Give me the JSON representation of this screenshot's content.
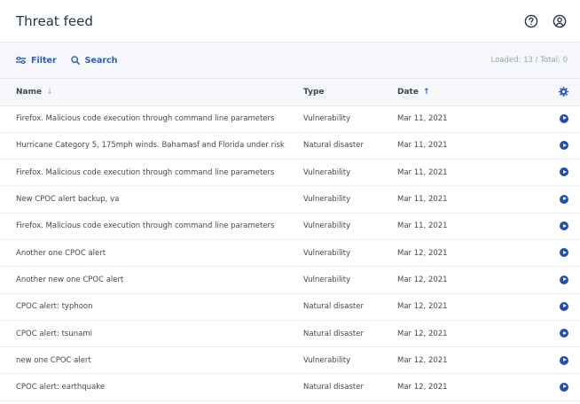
{
  "header": {
    "title": "Threat feed",
    "help_icon": "help-circle-icon",
    "account_icon": "user-circle-icon"
  },
  "toolbar": {
    "filter_label": "Filter",
    "search_label": "Search",
    "loaded_text": "Loaded: 13 / Total: 0"
  },
  "table": {
    "columns": {
      "name": "Name",
      "type": "Type",
      "date": "Date"
    },
    "sort": {
      "column": "Date",
      "direction": "ascending"
    },
    "rows": [
      {
        "name": "Firefox. Malicious code execution through command line parameters",
        "type": "Vulnerability",
        "date": "Mar 11, 2021"
      },
      {
        "name": "Hurricane Category 5, 175mph winds. Bahamasf and Florida under risk",
        "type": "Natural disaster",
        "date": "Mar 11, 2021"
      },
      {
        "name": "Firefox. Malicious code execution through command line parameters",
        "type": "Vulnerability",
        "date": "Mar 11, 2021"
      },
      {
        "name": "New CPOC alert backup, va",
        "type": "Vulnerability",
        "date": "Mar 11, 2021"
      },
      {
        "name": "Firefox. Malicious code execution through command line parameters",
        "type": "Vulnerability",
        "date": "Mar 11, 2021"
      },
      {
        "name": "Another one CPOC alert",
        "type": "Vulnerability",
        "date": "Mar 12, 2021"
      },
      {
        "name": "Another new one CPOC alert",
        "type": "Vulnerability",
        "date": "Mar 12, 2021"
      },
      {
        "name": "CPOC alert: typhoon",
        "type": "Natural disaster",
        "date": "Mar 12, 2021"
      },
      {
        "name": "CPOC alert: tsunami",
        "type": "Natural disaster",
        "date": "Mar 12, 2021"
      },
      {
        "name": "new one CPOC alert",
        "type": "Vulnerability",
        "date": "Mar 12, 2021"
      },
      {
        "name": "CPOC alert: earthquake",
        "type": "Natural disaster",
        "date": "Mar 12, 2021"
      }
    ]
  },
  "colors": {
    "accent": "#2b5fbe",
    "play": "#1e4fb4",
    "toolbar_bg": "#f5f7fb"
  }
}
